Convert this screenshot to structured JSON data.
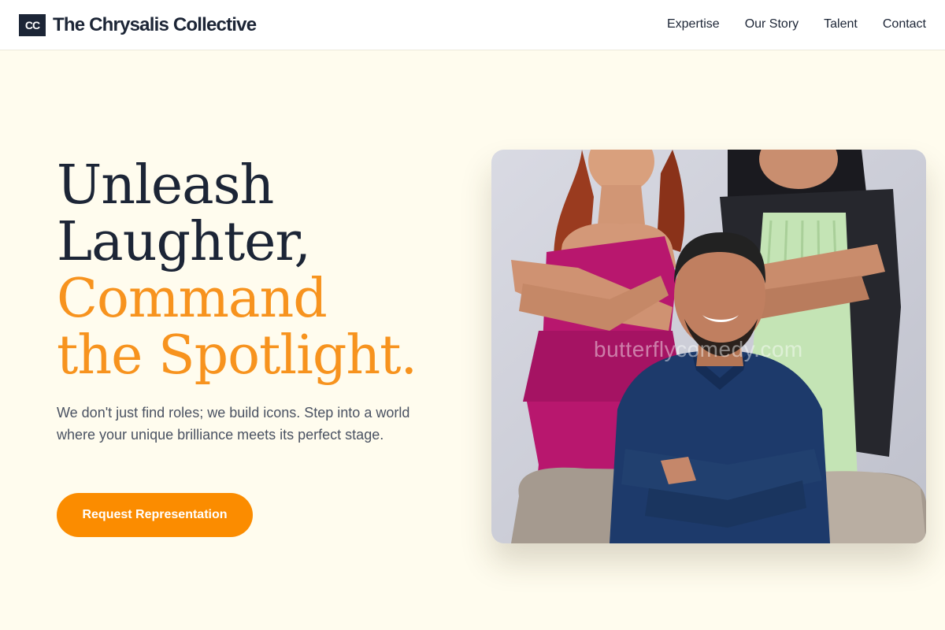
{
  "header": {
    "logo_mark": "CC",
    "logo_text": "The Chrysalis Collective",
    "nav": [
      "Expertise",
      "Our Story",
      "Talent",
      "Contact"
    ]
  },
  "hero": {
    "title_line1": "Unleash",
    "title_line2": "Laughter,",
    "title_line3": "Command",
    "title_line4": "the Spotlight.",
    "description": "We don't just find roles; we build icons. Step into a world where your unique brilliance meets its perfect stage.",
    "cta_label": "Request Representation"
  },
  "photo": {
    "watermark": "butterflycomedy.com",
    "alt": "three comedians posing with crossed arms"
  },
  "colors": {
    "accent": "#f7931e",
    "button": "#fb8c00",
    "navy": "#1c2536",
    "background": "#fffcee"
  }
}
